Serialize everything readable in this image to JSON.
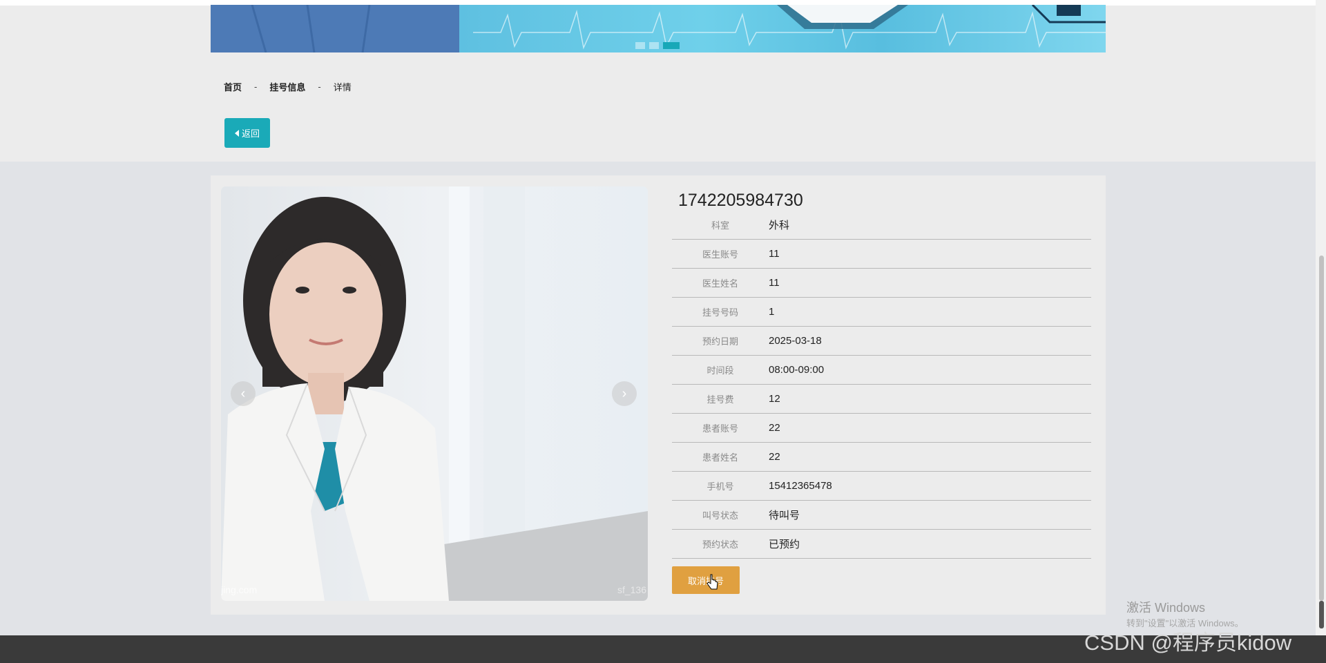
{
  "banner": {
    "slides": 3,
    "active_slide": 3
  },
  "breadcrumb": {
    "home": "首页",
    "section": "挂号信息",
    "current": "详情",
    "separator": "-"
  },
  "back_button": {
    "label": "返回"
  },
  "photo": {
    "watermark_left": "jing.com",
    "watermark_right": "sf_136"
  },
  "record": {
    "id": "1742205984730",
    "fields": [
      {
        "label": "科室",
        "value": "外科"
      },
      {
        "label": "医生账号",
        "value": "11"
      },
      {
        "label": "医生姓名",
        "value": "11"
      },
      {
        "label": "挂号号码",
        "value": "1"
      },
      {
        "label": "预约日期",
        "value": "2025-03-18"
      },
      {
        "label": "时间段",
        "value": "08:00-09:00"
      },
      {
        "label": "挂号费",
        "value": "12"
      },
      {
        "label": "患者账号",
        "value": "22"
      },
      {
        "label": "患者姓名",
        "value": "22"
      },
      {
        "label": "手机号",
        "value": "15412365478"
      },
      {
        "label": "叫号状态",
        "value": "待叫号"
      },
      {
        "label": "预约状态",
        "value": "已预约"
      }
    ]
  },
  "cancel_button": {
    "label": "取消挂号"
  },
  "overlay": {
    "windows_activate_title": "激活 Windows",
    "windows_activate_sub": "转到\"设置\"以激活 Windows。",
    "csdn_watermark": "CSDN @程序员kidow"
  },
  "colors": {
    "accent_teal": "#1aaab8",
    "cancel_orange": "#e0a040",
    "footer": "#3a3a3a"
  }
}
